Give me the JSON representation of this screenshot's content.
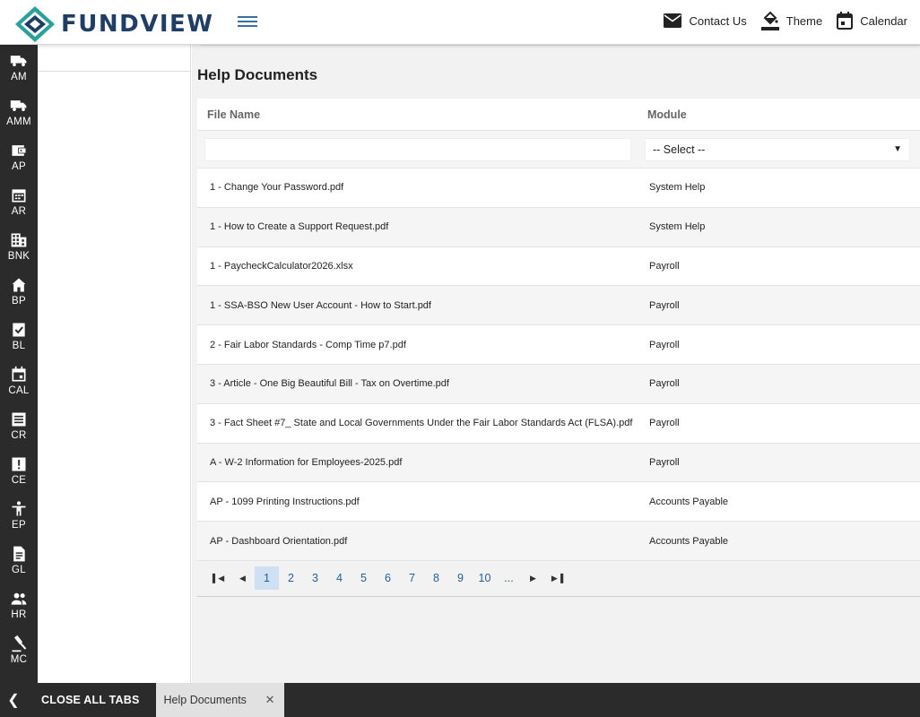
{
  "header": {
    "brand": "FUNDVIEW",
    "actions": [
      {
        "label": "Contact Us",
        "icon": "mail-icon"
      },
      {
        "label": "Theme",
        "icon": "paint-bucket-icon"
      },
      {
        "label": "Calendar",
        "icon": "calendar-icon"
      }
    ]
  },
  "rail": [
    {
      "label": "AM",
      "icon": "truck-icon"
    },
    {
      "label": "AMM",
      "icon": "truck-icon"
    },
    {
      "label": "AP",
      "icon": "wallet-icon"
    },
    {
      "label": "AR",
      "icon": "calendar-grid-icon"
    },
    {
      "label": "BNK",
      "icon": "bank-building-icon"
    },
    {
      "label": "BP",
      "icon": "home-icon"
    },
    {
      "label": "BL",
      "icon": "checklist-icon"
    },
    {
      "label": "CAL",
      "icon": "calendar-icon"
    },
    {
      "label": "CR",
      "icon": "document-lines-icon"
    },
    {
      "label": "CE",
      "icon": "alert-icon"
    },
    {
      "label": "EP",
      "icon": "person-icon"
    },
    {
      "label": "GL",
      "icon": "file-icon"
    },
    {
      "label": "HR",
      "icon": "people-icon"
    },
    {
      "label": "MC",
      "icon": "gavel-icon"
    }
  ],
  "page": {
    "title": "Help Documents"
  },
  "grid": {
    "columns": [
      "File Name",
      "Module"
    ],
    "filter": {
      "file_value": "",
      "module_selected": "-- Select --"
    },
    "rows": [
      {
        "file": "1 - Change Your Password.pdf",
        "module": "System Help"
      },
      {
        "file": "1 - How to Create a Support Request.pdf",
        "module": "System Help"
      },
      {
        "file": "1 - PaycheckCalculator2026.xlsx",
        "module": "Payroll"
      },
      {
        "file": "1 - SSA-BSO New User Account - How to Start.pdf",
        "module": "Payroll"
      },
      {
        "file": "2 - Fair Labor Standards - Comp Time p7.pdf",
        "module": "Payroll"
      },
      {
        "file": "3 - Article - One Big Beautiful Bill - Tax on Overtime.pdf",
        "module": "Payroll"
      },
      {
        "file": "3 - Fact Sheet #7_ State and Local Governments Under the Fair Labor Standards Act (FLSA).pdf",
        "module": "Payroll"
      },
      {
        "file": "A - W-2 Information for Employees-2025.pdf",
        "module": "Payroll"
      },
      {
        "file": "AP - 1099 Printing Instructions.pdf",
        "module": "Accounts Payable"
      },
      {
        "file": "AP - Dashboard Orientation.pdf",
        "module": "Accounts Payable"
      }
    ],
    "pager": {
      "pages": [
        "1",
        "2",
        "3",
        "4",
        "5",
        "6",
        "7",
        "8",
        "9",
        "10",
        "..."
      ],
      "current": "1"
    }
  },
  "bottom_bar": {
    "close_all_label": "CLOSE ALL TABS",
    "tabs": [
      {
        "label": "Help Documents"
      }
    ]
  },
  "colors": {
    "brand_navy": "#1f3e66",
    "brand_teal": "#2aa198",
    "rail_bg": "#2b2b2b",
    "pager_active": "#cfe0f3",
    "link_blue": "#1f5f9e"
  }
}
